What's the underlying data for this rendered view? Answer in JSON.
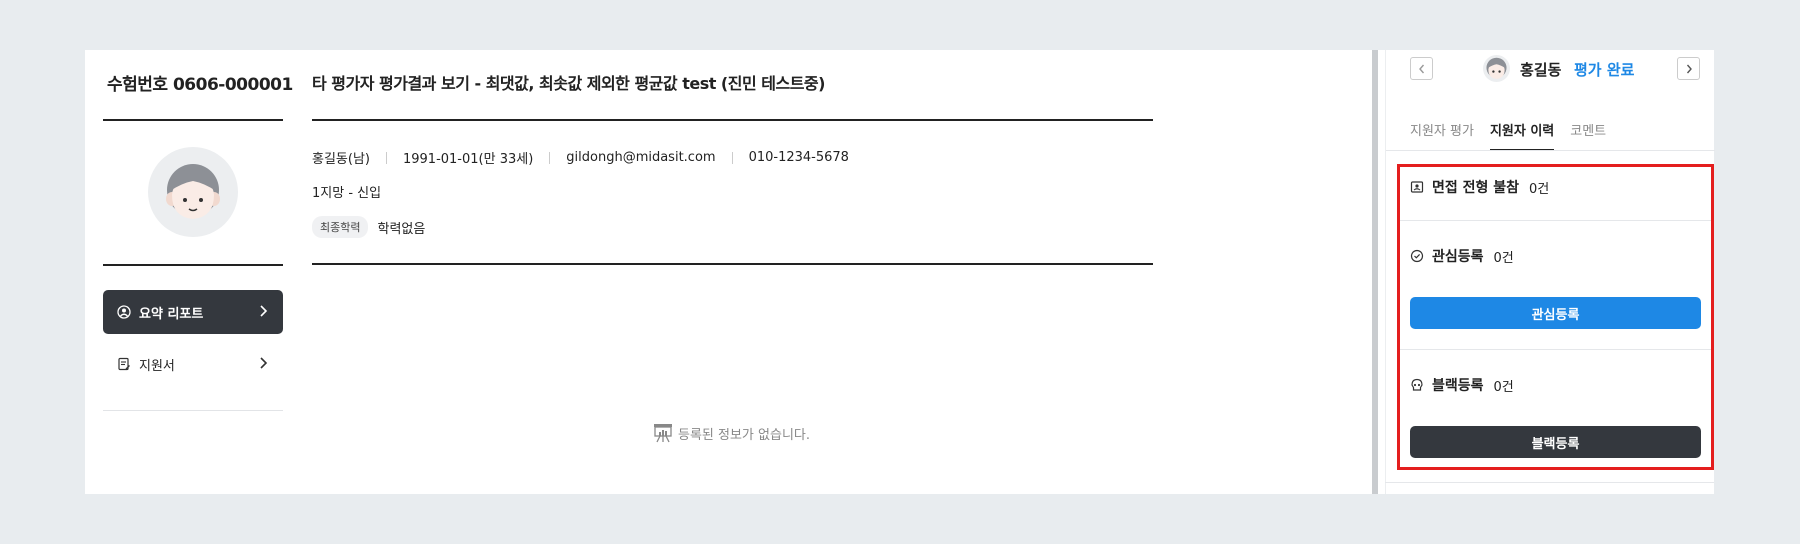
{
  "applicant": {
    "exam_number": "수험번호 0606-000001",
    "name_gender": "홍길동(남)",
    "birth": "1991-01-01(만 33세)",
    "email": "gildongh@midasit.com",
    "phone": "010-1234-5678",
    "application": "1지망 - 신입",
    "education_badge": "최종학력",
    "education_value": "학력없음"
  },
  "main": {
    "title": "타 평가자 평가결과 보기 - 최댓값, 최솟값 제외한 평균값 test (진민 테스트중)",
    "empty_message": "등록된 정보가 없습니다."
  },
  "left_menu": {
    "items": [
      {
        "label": "요약 리포트",
        "icon": "user-circle-icon",
        "active": true
      },
      {
        "label": "지원서",
        "icon": "document-edit-icon",
        "active": false
      }
    ]
  },
  "right_panel": {
    "candidate_name": "홍길동",
    "evaluation_status": "평가 완료",
    "tabs": [
      {
        "label": "지원자 평가",
        "active": false
      },
      {
        "label": "지원자 이력",
        "active": true
      },
      {
        "label": "코멘트",
        "active": false
      }
    ],
    "interview_absent": {
      "title": "면접 전형 불참",
      "count": "0건"
    },
    "interest": {
      "title": "관심등록",
      "count": "0건",
      "button": "관심등록"
    },
    "blacklist": {
      "title": "블랙등록",
      "count": "0건",
      "button": "블랙등록"
    }
  },
  "colors": {
    "accent_blue": "#1e88e5",
    "dark": "#34383e",
    "highlight": "#e41e1e"
  }
}
